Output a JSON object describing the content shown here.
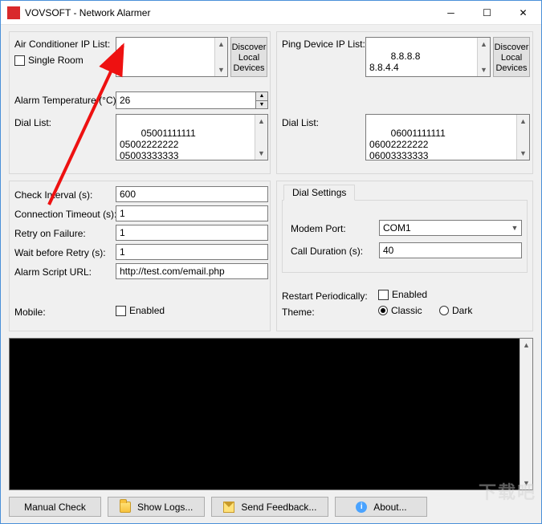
{
  "window": {
    "title": "VOVSOFT - Network Alarmer"
  },
  "left": {
    "ac_ip_label": "Air Conditioner IP List:",
    "single_room_label": "Single Room",
    "ac_ip_value": "",
    "discover_label": "Discover\nLocal\nDevices",
    "alarm_temp_label": "Alarm Temperature (°C):",
    "alarm_temp_value": "26",
    "dial_label": "Dial List:",
    "dial_value": "05001111111\n05002222222\n05003333333"
  },
  "right": {
    "ping_label": "Ping Device IP List:",
    "ping_value": "8.8.8.8\n8.8.4.4",
    "discover_label": "Discover\nLocal\nDevices",
    "dial_label": "Dial List:",
    "dial_value": "06001111111\n06002222222\n06003333333"
  },
  "settings": {
    "check_interval_label": "Check Interval (s):",
    "check_interval_value": "600",
    "conn_timeout_label": "Connection Timeout (s):",
    "conn_timeout_value": "1",
    "retry_label": "Retry on Failure:",
    "retry_value": "1",
    "wait_label": "Wait before Retry (s):",
    "wait_value": "1",
    "script_label": "Alarm Script URL:",
    "script_value": "http://test.com/email.php",
    "mobile_label": "Mobile:",
    "mobile_enabled_label": "Enabled"
  },
  "dial": {
    "tab_label": "Dial Settings",
    "modem_label": "Modem Port:",
    "modem_value": "COM1",
    "duration_label": "Call Duration (s):",
    "duration_value": "40"
  },
  "restart": {
    "label": "Restart Periodically:",
    "enabled_label": "Enabled"
  },
  "theme": {
    "label": "Theme:",
    "classic": "Classic",
    "dark": "Dark",
    "selected": "classic"
  },
  "buttons": {
    "manual_check": "Manual Check",
    "show_logs": "Show Logs...",
    "send_feedback": "Send Feedback...",
    "about": "About..."
  },
  "watermark": "下载吧"
}
